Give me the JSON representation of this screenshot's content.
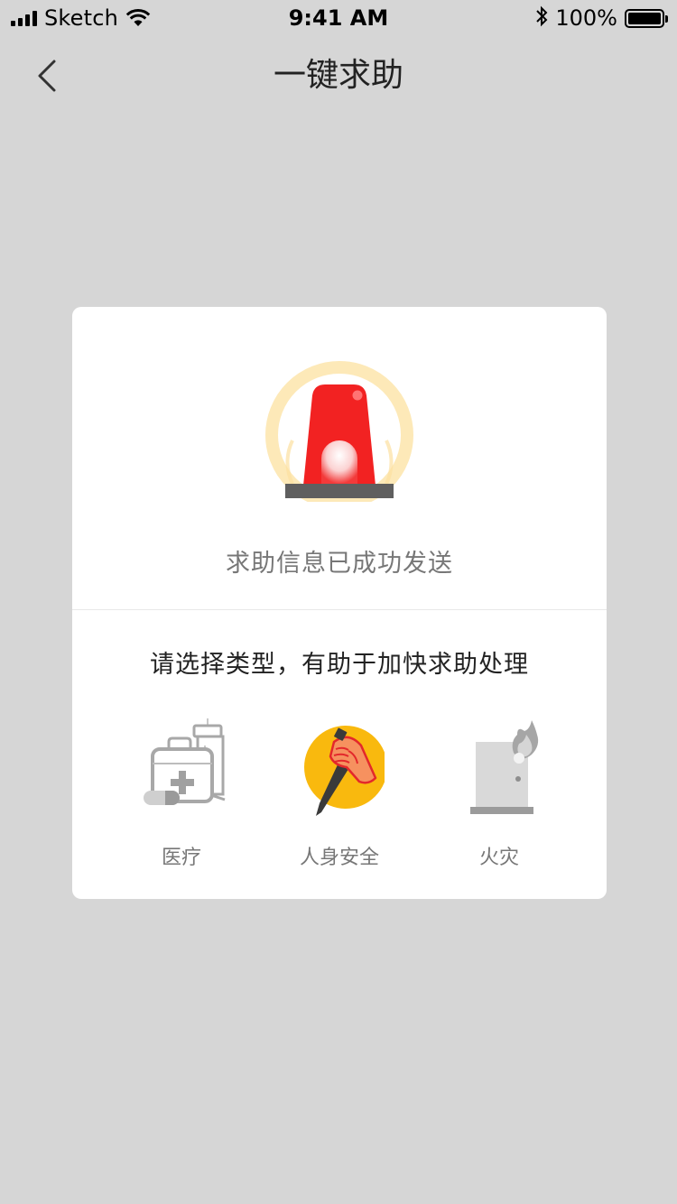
{
  "status_bar": {
    "carrier": "Sketch",
    "time": "9:41 AM",
    "battery": "100%",
    "battery_level": 1.0
  },
  "nav": {
    "title": "一键求助",
    "back_icon": "chevron-left-icon"
  },
  "card": {
    "alarm_icon": "siren-icon",
    "success_message": "求助信息已成功发送",
    "prompt": "请选择类型，有助于加快求助处理",
    "options": [
      {
        "label": "医疗",
        "icon": "medical-kit-icon"
      },
      {
        "label": "人身安全",
        "icon": "knife-hand-icon"
      },
      {
        "label": "火灾",
        "icon": "fire-door-icon"
      }
    ]
  },
  "colors": {
    "background": "#d6d6d6",
    "card": "#ffffff",
    "alarm_red": "#f22222",
    "alarm_glow": "#fde9b8",
    "safety_yellow": "#f9b90e",
    "icon_grey": "#a6a6a6"
  }
}
